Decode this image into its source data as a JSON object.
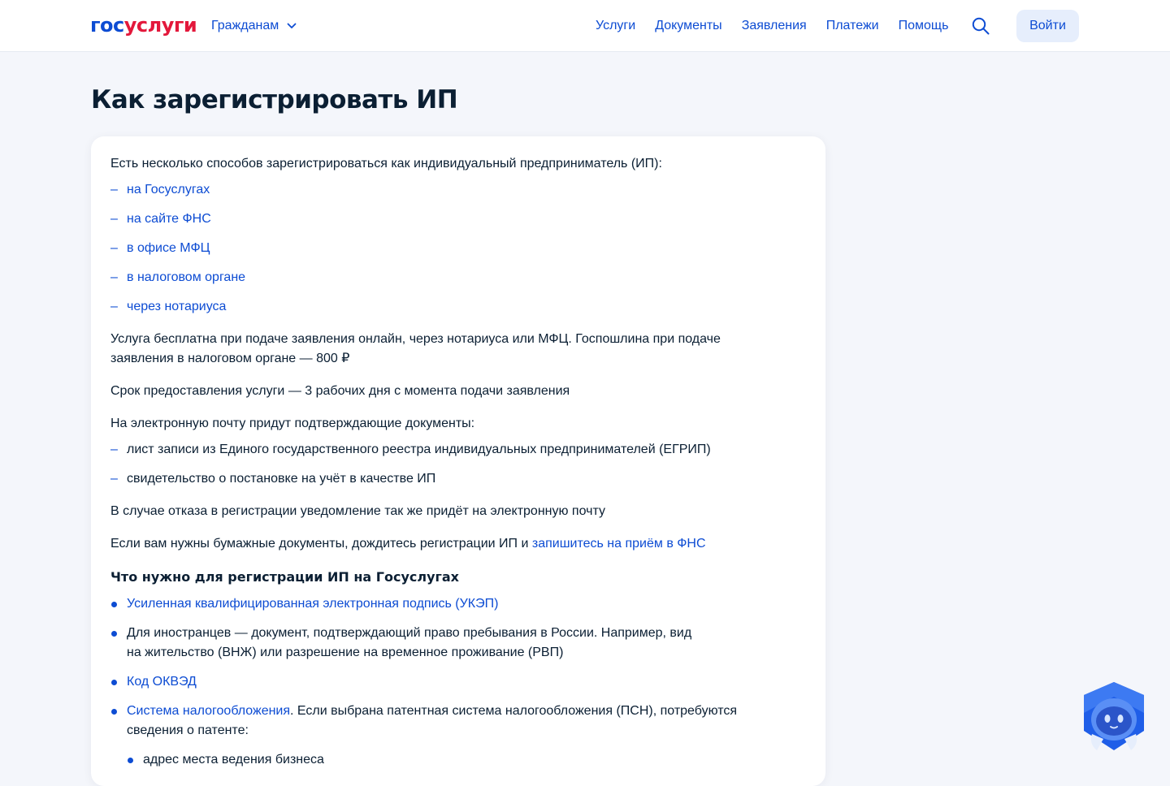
{
  "header": {
    "logo_part1": "гос",
    "logo_part2": "услуги",
    "audience": "Гражданам",
    "nav": [
      "Услуги",
      "Документы",
      "Заявления",
      "Платежи",
      "Помощь"
    ],
    "login": "Войти"
  },
  "page": {
    "title": "Как зарегистрировать ИП"
  },
  "content": {
    "intro": "Есть несколько способов зарегистрироваться как индивидуальный предприниматель (ИП):",
    "ways": [
      "на Госуслугах",
      "на сайте ФНС",
      "в офисе МФЦ",
      "в налоговом органе",
      "через нотариуса"
    ],
    "fee_text": "Услуга бесплатна при подаче заявления онлайн, через нотариуса или МФЦ. Госпошлина при подаче заявления в налоговом органе — 800 ₽",
    "term_text": "Срок предоставления услуги — 3 рабочих дня с момента подачи заявления",
    "email_text": "На электронную почту придут подтверждающие документы:",
    "email_docs": [
      "лист записи из Единого государственного реестра индивидуальных предпринимателей (ЕГРИП)",
      "свидетельство о постановке на учёт в качестве ИП"
    ],
    "refusal_text": "В случае отказа в регистрации уведомление так же придёт на электронную почту",
    "paper_text": "Если вам нужны бумажные документы, дождитесь регистрации ИП и",
    "paper_link": "запишитесь на приём в ФНС",
    "section_title": "Что нужно для регистрации ИП на Госуслугах",
    "req_ukep": "Усиленная квалифицированная электронная подпись (УКЭП)",
    "req_foreign": "Для иностранцев — документ, подтверждающий право пребывания в России. Например, вид на жительство (ВНЖ) или разрешение на временное проживание (РВП)",
    "req_okved": "Код ОКВЭД",
    "req_tax_link": "Система налогообложения",
    "req_tax_text": ". Если выбрана патентная система налогообложения (ПСН), потребуются сведения о патенте:",
    "req_tax_sub": [
      "адрес места ведения бизнеса"
    ]
  },
  "colors": {
    "accent": "#0d4cd3",
    "logo_red": "#e3183b",
    "background": "#f4f6fb",
    "text": "#0b1f33"
  },
  "icons": {
    "audience_chevron": "chevron-down-icon",
    "search": "search-icon",
    "assistant": "robot-assistant-icon"
  }
}
